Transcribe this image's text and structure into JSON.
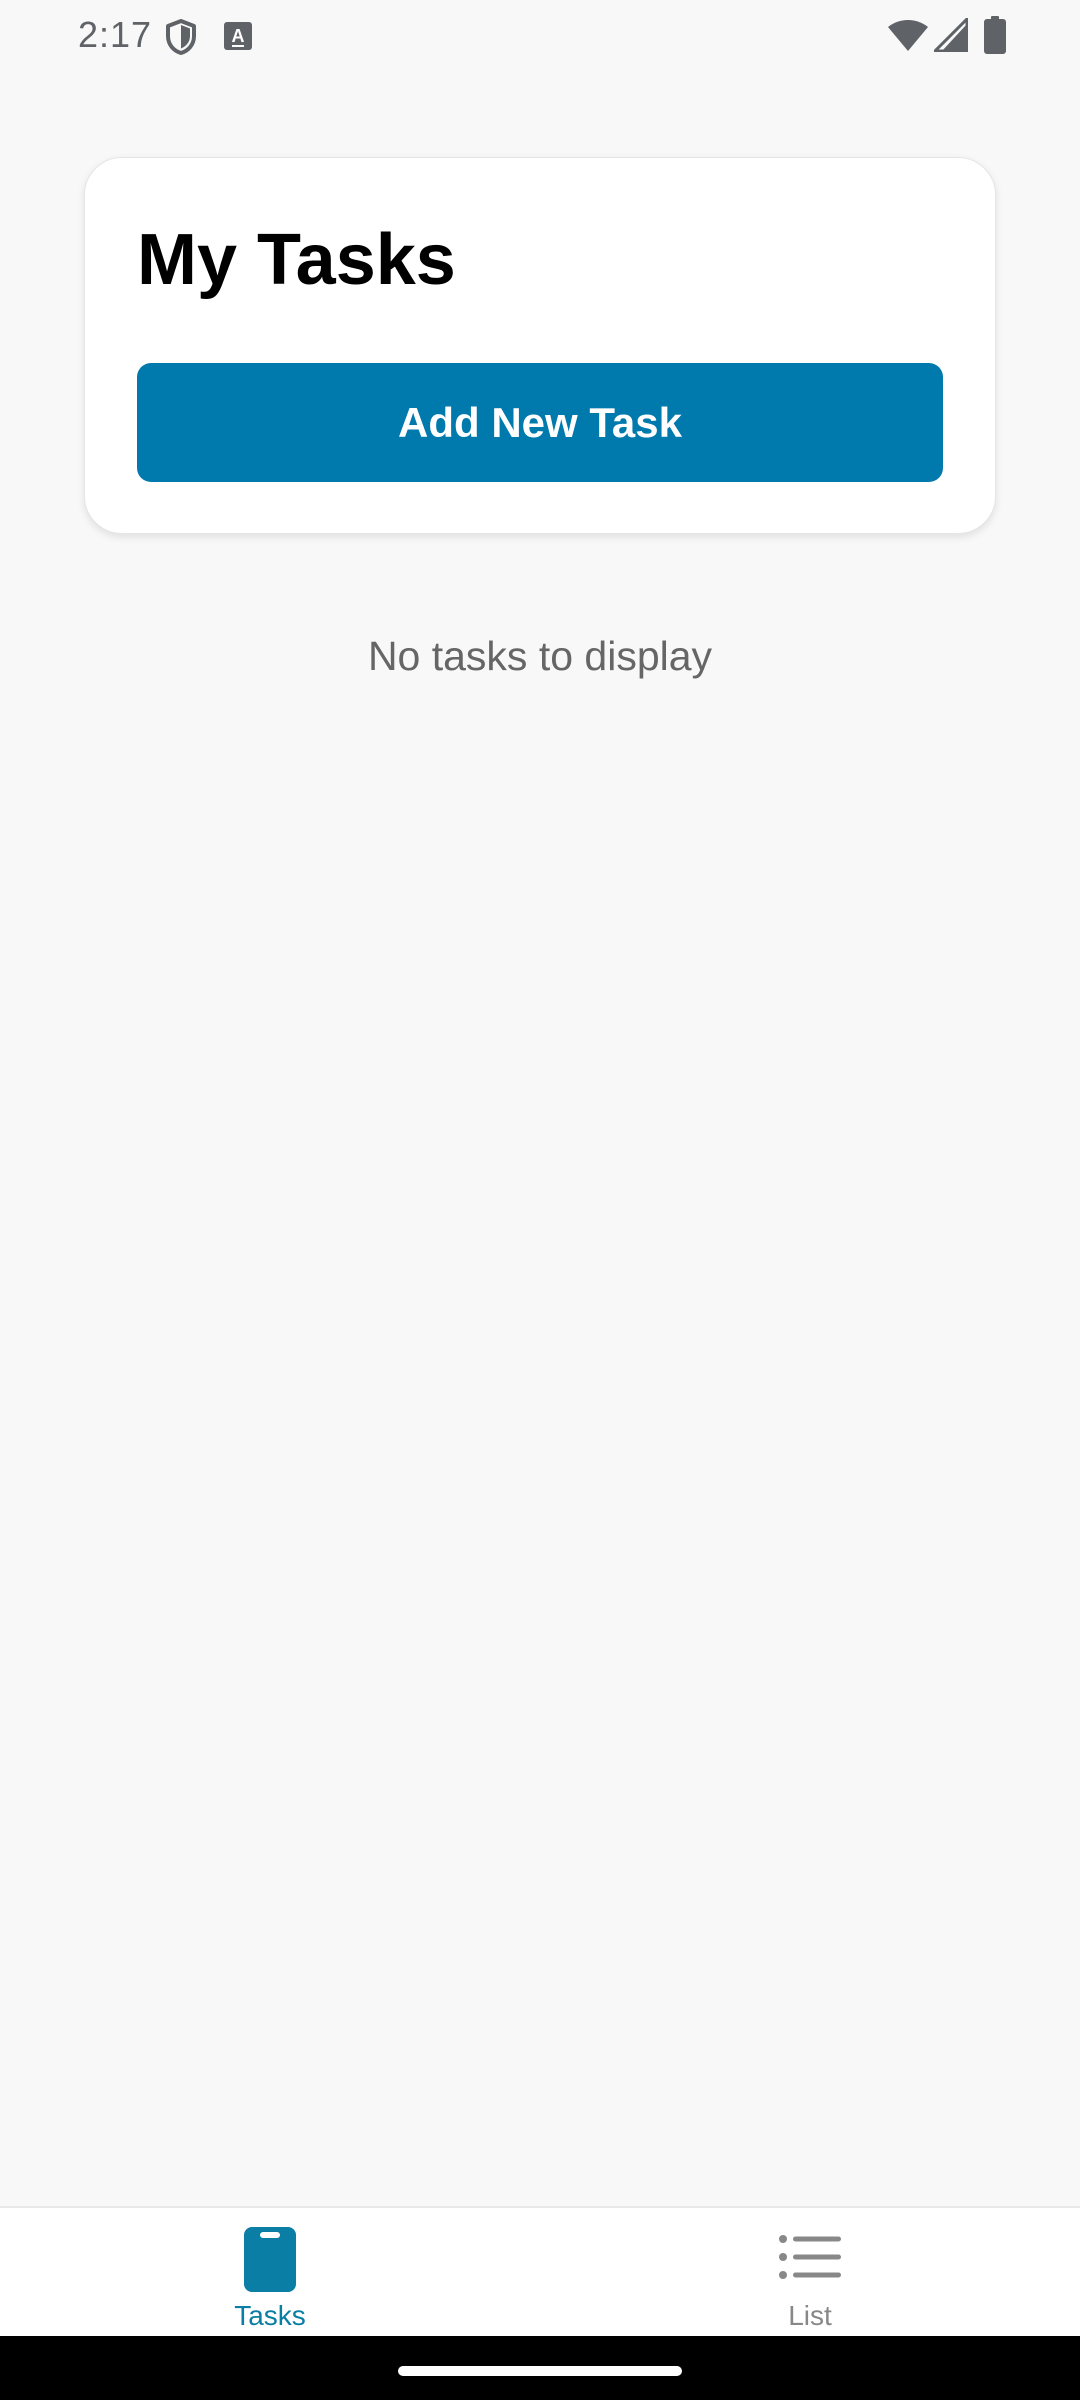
{
  "status_bar": {
    "time": "2:17",
    "left_icons": [
      "shield-icon",
      "keyboard-a-icon"
    ],
    "right_icons": [
      "wifi-icon",
      "cell-signal-icon",
      "battery-icon"
    ]
  },
  "header": {
    "title": "My Tasks",
    "add_button_label": "Add New Task"
  },
  "main": {
    "empty_message": "No tasks to display"
  },
  "bottom_nav": {
    "tabs": [
      {
        "label": "Tasks",
        "icon": "clipboard-icon",
        "active": true
      },
      {
        "label": "List",
        "icon": "list-icon",
        "active": false
      }
    ]
  },
  "colors": {
    "accent": "#0079ad",
    "active_tab": "#0a7ea4",
    "inactive_tab": "#888888",
    "background": "#f8f8f8",
    "card": "#ffffff"
  }
}
